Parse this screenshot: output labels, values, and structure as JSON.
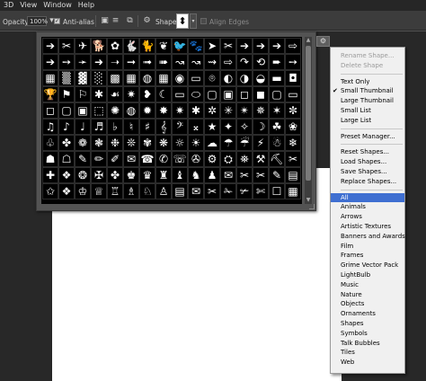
{
  "menubar": [
    "3D",
    "View",
    "Window",
    "Help"
  ],
  "options": {
    "opacity_label": "Opacity:",
    "opacity_value": "100%",
    "antialias_label": "Anti-alias",
    "shape_label": "Shape:",
    "align_edges_label": "Align Edges",
    "shape_preview": "⬍"
  },
  "shapes": [
    "➔",
    "✂",
    "✈",
    "🐕",
    "✿",
    "🐇",
    "🐈",
    "❦",
    "🐦",
    "🐾",
    "➤",
    "✂",
    "➔",
    "➔",
    "➔",
    "⇨",
    "➔",
    "➙",
    "➛",
    "➜",
    "➝",
    "➞",
    "➟",
    "➠",
    "↝",
    "↝",
    "⇝",
    "⇨",
    "↷",
    "⟲",
    "➨",
    "➙",
    "▦",
    "▒",
    "▓",
    "░",
    "▩",
    "▦",
    "◍",
    "▦",
    "◉",
    "▭",
    "⌾",
    "◐",
    "◑",
    "◒",
    "▬",
    "◘",
    "🏆",
    "⚑",
    "⚐",
    "✱",
    "☙",
    "✷",
    "❥",
    "☾",
    "▭",
    "⬭",
    "▢",
    "▣",
    "◻",
    "◼",
    "▢",
    "▭",
    "◻",
    "▢",
    "▣",
    "⬚",
    "✺",
    "◍",
    "✹",
    "✸",
    "✷",
    "✱",
    "✲",
    "✳",
    "✴",
    "✵",
    "✶",
    "✼",
    "♫",
    "♪",
    "♩",
    "♬",
    "♭",
    "♮",
    "♯",
    "𝄞",
    "𝄢",
    "𝄪",
    "★",
    "✦",
    "✧",
    "☽",
    "☘",
    "❀",
    "♧",
    "✤",
    "❁",
    "❃",
    "❉",
    "❊",
    "✾",
    "❋",
    "☼",
    "☀",
    "☁",
    "☂",
    "☔",
    "⚡",
    "☃",
    "❄",
    "☗",
    "☖",
    "✎",
    "✏",
    "✐",
    "✉",
    "☎",
    "✆",
    "☏",
    "✇",
    "⚙",
    "⛭",
    "⛯",
    "⚒",
    "⛏",
    "✂",
    "✚",
    "❖",
    "❂",
    "✠",
    "✤",
    "♚",
    "♛",
    "♜",
    "♝",
    "♞",
    "♟",
    "✉",
    "✂",
    "✂",
    "✎",
    "▤",
    "✩",
    "❖",
    "♔",
    "♕",
    "♖",
    "♗",
    "♘",
    "♙",
    "▤",
    "✉",
    "✂",
    "✁",
    "✃",
    "✄",
    "☐",
    "▦"
  ],
  "menu": {
    "items": [
      {
        "label": "Rename Shape...",
        "state": "disabled"
      },
      {
        "label": "Delete Shape",
        "state": "disabled"
      },
      {
        "label": "divider"
      },
      {
        "label": "Text Only",
        "state": "normal"
      },
      {
        "label": "Small Thumbnail",
        "state": "checked"
      },
      {
        "label": "Large Thumbnail",
        "state": "normal"
      },
      {
        "label": "Small List",
        "state": "normal"
      },
      {
        "label": "Large List",
        "state": "normal"
      },
      {
        "label": "divider"
      },
      {
        "label": "Preset Manager...",
        "state": "normal"
      },
      {
        "label": "divider"
      },
      {
        "label": "Reset Shapes...",
        "state": "normal"
      },
      {
        "label": "Load Shapes...",
        "state": "normal"
      },
      {
        "label": "Save Shapes...",
        "state": "normal"
      },
      {
        "label": "Replace Shapes...",
        "state": "normal"
      },
      {
        "label": "divider"
      },
      {
        "label": "All",
        "state": "selected"
      },
      {
        "label": "Animals",
        "state": "normal"
      },
      {
        "label": "Arrows",
        "state": "normal"
      },
      {
        "label": "Artistic Textures",
        "state": "normal"
      },
      {
        "label": "Banners and Awards",
        "state": "normal"
      },
      {
        "label": "Film",
        "state": "normal"
      },
      {
        "label": "Frames",
        "state": "normal"
      },
      {
        "label": "Grime Vector Pack",
        "state": "normal"
      },
      {
        "label": "LightBulb",
        "state": "normal"
      },
      {
        "label": "Music",
        "state": "normal"
      },
      {
        "label": "Nature",
        "state": "normal"
      },
      {
        "label": "Objects",
        "state": "normal"
      },
      {
        "label": "Ornaments",
        "state": "normal"
      },
      {
        "label": "Shapes",
        "state": "normal"
      },
      {
        "label": "Symbols",
        "state": "normal"
      },
      {
        "label": "Talk Bubbles",
        "state": "normal"
      },
      {
        "label": "Tiles",
        "state": "normal"
      },
      {
        "label": "Web",
        "state": "normal"
      }
    ]
  }
}
